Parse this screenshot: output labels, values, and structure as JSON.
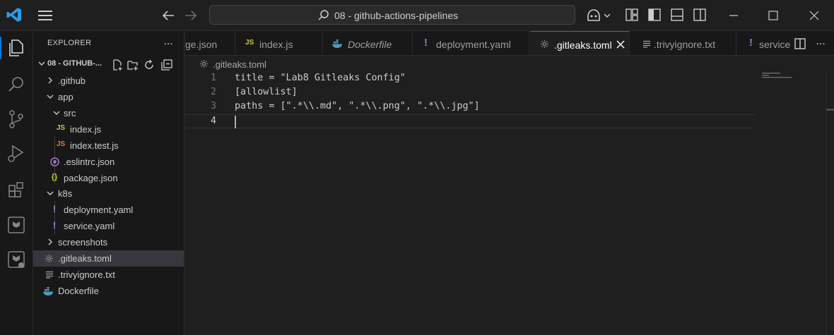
{
  "titlebar": {
    "search_text": "08 - github-actions-pipelines",
    "icons": {
      "logo": "vscode-logo-icon",
      "menu": "hamburger-menu-icon",
      "back": "arrow-left-icon",
      "forward": "arrow-right-icon",
      "search": "search-icon",
      "copilot": "copilot-icon",
      "layouts": [
        "customize-layout-icon",
        "toggle-primary-sidebar-icon",
        "toggle-panel-icon",
        "toggle-secondary-sidebar-icon"
      ],
      "window": [
        "minimize-icon",
        "maximize-icon",
        "close-icon"
      ]
    }
  },
  "activitybar": {
    "items": [
      "explorer-icon",
      "search-icon",
      "source-control-icon",
      "run-debug-icon",
      "extensions-icon",
      "terraform-icon",
      "terraform-cloud-icon"
    ]
  },
  "sidebar": {
    "title": "EXPLORER",
    "more": "...",
    "folder": "08 - GITHUB-...",
    "tree": [
      {
        "label": ".github",
        "type": "folder",
        "expanded": false,
        "depth": 1
      },
      {
        "label": "app",
        "type": "folder",
        "expanded": true,
        "depth": 1
      },
      {
        "label": "src",
        "type": "folder",
        "expanded": true,
        "depth": 2
      },
      {
        "label": "index.js",
        "type": "js",
        "icon": "JS",
        "depth": 3
      },
      {
        "label": "index.test.js",
        "type": "test-js",
        "icon": "JS",
        "depth": 3
      },
      {
        "label": ".eslintrc.json",
        "type": "eslint",
        "icon": "eslint-icon",
        "depth": 2
      },
      {
        "label": "package.json",
        "type": "json",
        "icon": "{}",
        "depth": 2
      },
      {
        "label": "k8s",
        "type": "folder",
        "expanded": true,
        "depth": 1
      },
      {
        "label": "deployment.yaml",
        "type": "yaml",
        "icon": "!",
        "depth": 2
      },
      {
        "label": "service.yaml",
        "type": "yaml",
        "icon": "!",
        "depth": 2
      },
      {
        "label": "screenshots",
        "type": "folder",
        "expanded": false,
        "depth": 1
      },
      {
        "label": ".gitleaks.toml",
        "type": "toml",
        "icon": "gear-icon",
        "depth": 1,
        "selected": true
      },
      {
        "label": ".trivyignore.txt",
        "type": "txt",
        "icon": "lines-icon",
        "depth": 1
      },
      {
        "label": "Dockerfile",
        "type": "docker",
        "icon": "docker-icon",
        "depth": 1
      }
    ]
  },
  "tabs": [
    {
      "label": "ge.json",
      "icon": ""
    },
    {
      "label": "index.js",
      "icon": "JS"
    },
    {
      "label": "Dockerfile",
      "icon": "docker-icon",
      "italic": true
    },
    {
      "label": "deployment.yaml",
      "icon": "!"
    },
    {
      "label": ".gitleaks.toml",
      "icon": "gear-icon",
      "active": true
    },
    {
      "label": ".trivyignore.txt",
      "icon": "lines-icon"
    },
    {
      "label": "service",
      "icon": "!"
    }
  ],
  "breadcrumb": {
    "label": ".gitleaks.toml"
  },
  "editor": {
    "lines": [
      {
        "num": "1",
        "text": "title = \"Lab8 Gitleaks Config\""
      },
      {
        "num": "2",
        "text": "[allowlist]"
      },
      {
        "num": "3",
        "text": "paths = [\".*\\\\.md\", \".*\\\\.png\", \".*\\\\.jpg\"]"
      },
      {
        "num": "4",
        "text": ""
      }
    ],
    "cursor_line": 4
  },
  "colors": {
    "accent": "#0078d4",
    "js": "#cbcb41",
    "test_js": "#e37933",
    "yaml": "#a074c4",
    "json": "#cbcb41",
    "docker": "#519aba"
  }
}
